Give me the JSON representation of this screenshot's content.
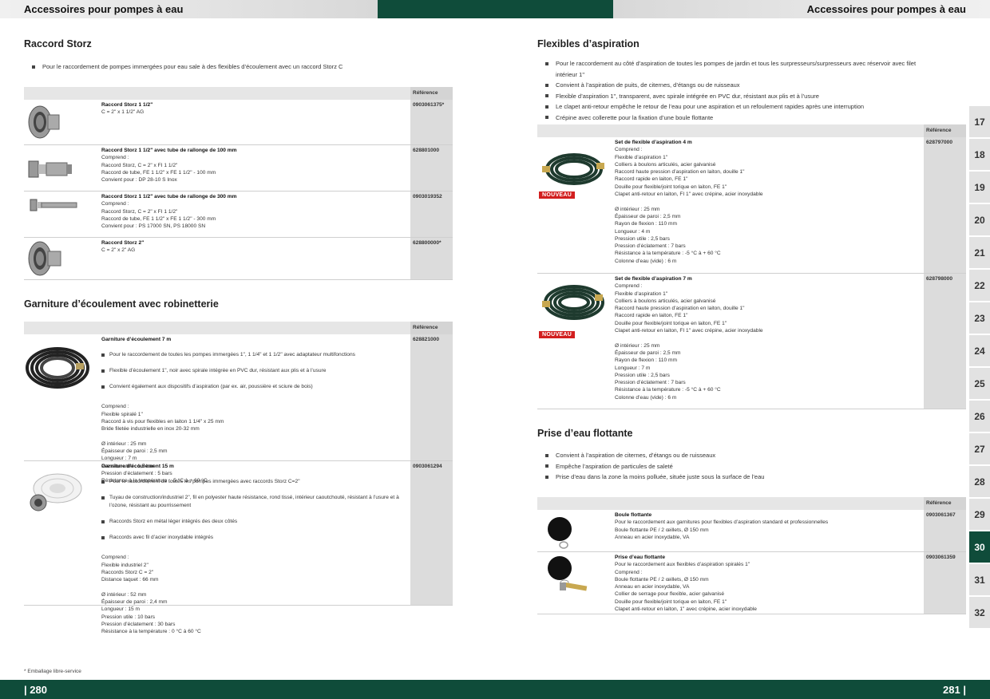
{
  "header": {
    "left_title": "Accessoires pour pompes à eau",
    "right_title": "Accessoires pour pompes à eau"
  },
  "ref_header": "Référence",
  "sections": {
    "storz": {
      "title": "Raccord Storz",
      "bullets": [
        "Pour le raccordement de pompes immergées pour eau sale à des flexibles d’écoulement avec un raccord Storz C"
      ],
      "rows": [
        {
          "name": "Raccord Storz 1 1/2\"",
          "details": "C = 2\" x 1 1/2\" AG",
          "ref": "0903061375*"
        },
        {
          "name": "Raccord Storz 1 1/2\" avec tube de rallonge de 100 mm",
          "details": "Comprend :\nRaccord Storz, C = 2\" x FI 1 1/2\"\nRaccord de tube, FE 1 1/2\" x FE 1 1/2\" - 100 mm\nConvient pour : DP 28-10 S Inox",
          "ref": "628801000"
        },
        {
          "name": "Raccord Storz 1 1/2\" avec tube de rallonge de 300 mm",
          "details": "Comprend :\nRaccord Storz, C = 2\" x FI 1 1/2\"\nRaccord de tube, FE 1 1/2\" x FE 1 1/2\" - 300 mm\nConvient pour : PS 17000 SN, PS 18000 SN",
          "ref": "0903019352"
        },
        {
          "name": "Raccord Storz 2\"",
          "details": "C = 2\" x 2\" AG",
          "ref": "628800000*"
        }
      ]
    },
    "garniture": {
      "title": "Garniture d’écoulement avec robinetterie",
      "rows": [
        {
          "name": "Garniture d’écoulement 7 m",
          "bullets": [
            "Pour le raccordement de toutes les pompes immergées 1\", 1 1/4\" et 1 1/2\" avec adaptateur multifonctions",
            "Flexible d’écoulement 1\", noir avec spirale intégrée en PVC dur, résistant aux plis et à l’usure",
            "Convient également aux dispositifs d’aspiration (par ex. air, poussière et sciure de bois)"
          ],
          "details": "Comprend :\nFlexible spiralé 1\"\nRaccord à vis pour flexibles en laiton 1 1/4\" x 25 mm\nBride filetée industrielle en inox 20-32 mm\n\nØ intérieur : 25 mm\nÉpaisseur de paroi : 2,5 mm\nLongueur : 7 m\nPression utile : 1,5 bar\nPression d’éclatement : 5 bars\nRésistance à la température : -5 °C à + 60 °C",
          "ref": "628821000"
        },
        {
          "name": "Garniture d’écoulement 15 m",
          "bullets": [
            "Pour le raccordement de toutes les pompes immergées avec raccords Storz C=2\"",
            "Tuyau de construction/industriel 2\", fil en polyester haute résistance, rond tissé, intérieur caoutchouté, résistant à l’usure et à l’ozone, résistant au pourrissement",
            "Raccords Storz en métal léger intégrés des deux côtés",
            "Raccords avec fil d’acier inoxydable intégrés"
          ],
          "details": "Comprend :\nFlexible industriel 2\"\nRaccords Storz C = 2\"\nDistance taquet : 66 mm\n\nØ intérieur : 52 mm\nÉpaisseur de paroi : 2,4 mm\nLongueur : 15 m\nPression utile : 10 bars\nPression d’éclatement : 30 bars\nRésistance à la température : 0 °C à 60 °C",
          "ref": "0903061294"
        }
      ]
    },
    "flexibles": {
      "title": "Flexibles d’aspiration",
      "bullets": [
        "Pour le raccordement au côté d’aspiration de toutes les pompes de jardin et tous les surpresseurs/surpresseurs avec réservoir avec filet intérieur 1\"",
        "Convient à l’aspiration de puits, de citernes, d’étangs ou de ruisseaux",
        "Flexible d’aspiration 1\", transparent, avec spirale intégrée en PVC dur, résistant aux plis et à l’usure",
        "Le clapet anti-retour empêche le retour de l’eau pour une aspiration et un refoulement rapides après une interruption",
        "Crépine avec collerette pour la fixation d’une boule flottante"
      ],
      "rows": [
        {
          "name": "Set de flexible d’aspiration 4 m",
          "badge": "NOUVEAU",
          "details": "Comprend :\nFlexible d’aspiration 1\"\nColliers à boulons articulés, acier galvanisé\nRaccord haute pression d’aspiration en laiton, douille 1\"\nRaccord rapide en laiton, FE 1\"\nDouille pour flexible/joint torique en laiton, FE 1\"\nClapet anti-retour en laiton, FI 1\" avec crépine, acier inoxydable\n\nØ intérieur : 25 mm\nÉpaisseur de paroi : 2,5 mm\nRayon de flexion : 110 mm\nLongueur : 4 m\nPression utile : 2,5 bars\nPression d’éclatement : 7 bars\nRésistance à la température : -5 °C à + 60 °C\nColonne d’eau (vide) : 6 m",
          "ref": "628797000"
        },
        {
          "name": "Set de flexible d’aspiration 7 m",
          "badge": "NOUVEAU",
          "details": "Comprend :\nFlexible d’aspiration 1\"\nColliers à boulons articulés, acier galvanisé\nRaccord haute pression d’aspiration en laiton, douille 1\"\nRaccord rapide en laiton, FE 1\"\nDouille pour flexible/joint torique en laiton, FE 1\"\nClapet anti-retour en laiton, FI 1\" avec crépine, acier inoxydable\n\nØ intérieur : 25 mm\nÉpaisseur de paroi : 2,5 mm\nRayon de flexion : 110 mm\nLongueur : 7 m\nPression utile : 2,5 bars\nPression d’éclatement : 7 bars\nRésistance à la température : -5 °C à + 60 °C\nColonne d’eau (vide) : 6 m",
          "ref": "628798000"
        }
      ]
    },
    "prise": {
      "title": "Prise d’eau flottante",
      "bullets": [
        "Convient à l’aspiration de citernes, d’étangs ou de ruisseaux",
        "Empêche l’aspiration de particules de saleté",
        "Prise d’eau dans la zone la moins polluée, située juste sous la surface de l’eau"
      ],
      "rows": [
        {
          "name": "Boule flottante",
          "details": "Pour le raccordement aux garnitures pour flexibles d’aspiration standard et professionnelles\nBoule flottante PE / 2 œillets, Ø 150 mm\nAnneau en acier inoxydable, VA",
          "ref": "0903061367"
        },
        {
          "name": "Prise d’eau flottante",
          "details": "Pour le raccordement aux flexibles d’aspiration spiralés 1\"\nComprend :\nBoule flottante PE / 2 œillets, Ø 150 mm\nAnneau en acier inoxydable, VA\nCollier de serrage pour flexible, acier galvanisé\nDouille pour flexible/joint torique en laiton, FE 1\"\nClapet anti-retour en laiton, 1\" avec crépine, acier inoxydable",
          "ref": "0903061359"
        }
      ]
    }
  },
  "tabs": [
    "17",
    "18",
    "19",
    "20",
    "21",
    "22",
    "23",
    "24",
    "25",
    "26",
    "27",
    "28",
    "29",
    "30",
    "31",
    "32"
  ],
  "active_tab": "30",
  "footnote": "* Emballage libre-service",
  "footer": {
    "left": "| 280",
    "right": "281 |"
  },
  "colors": {
    "brand_green": "#0f4c3a",
    "badge_red": "#d21f1f"
  }
}
